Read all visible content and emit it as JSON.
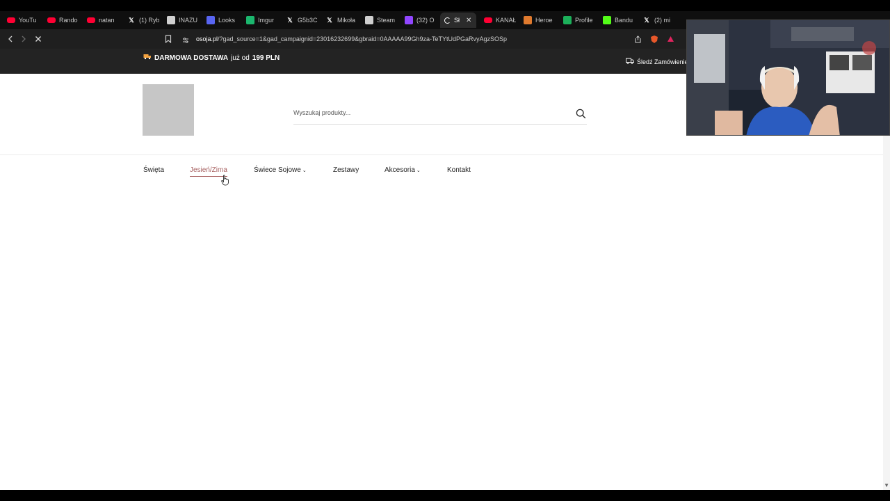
{
  "browser": {
    "tabs": [
      {
        "label": "YouTu",
        "icon": "youtube-icon",
        "color": "#ff0033"
      },
      {
        "label": "Rando",
        "icon": "youtube-icon",
        "color": "#ff0033"
      },
      {
        "label": "natan",
        "icon": "youtube-icon",
        "color": "#ff0033"
      },
      {
        "label": "(1) Ryb",
        "icon": "x-icon",
        "color": "#ffffff"
      },
      {
        "label": "INAZU",
        "icon": "stack-icon",
        "color": "#d0d0d0"
      },
      {
        "label": "Looks",
        "icon": "discord-icon",
        "color": "#5865f2"
      },
      {
        "label": "Imgur",
        "icon": "imgur-icon",
        "color": "#1bb76e"
      },
      {
        "label": "G5b3C",
        "icon": "x-icon",
        "color": "#ffffff"
      },
      {
        "label": "Mikoła",
        "icon": "x-icon",
        "color": "#ffffff"
      },
      {
        "label": "Steam",
        "icon": "stack-icon",
        "color": "#d0d0d0"
      },
      {
        "label": "(32) O",
        "icon": "twitch-icon",
        "color": "#9146ff"
      },
      {
        "label": "Sł",
        "icon": "loading-icon",
        "color": "#ffffff",
        "active": true
      },
      {
        "label": "KANAŁ",
        "icon": "youtube-icon",
        "color": "#ff0033"
      },
      {
        "label": "Heroe",
        "icon": "heroes-icon",
        "color": "#e07a2e"
      },
      {
        "label": "Profile",
        "icon": "profile-icon",
        "color": "#1cb05a"
      },
      {
        "label": "Bandu",
        "icon": "kick-icon",
        "color": "#53fc18"
      },
      {
        "label": "(2) mi",
        "icon": "x-icon",
        "color": "#ffffff"
      }
    ],
    "url_host": "osoja.pl",
    "url_path": "/?gad_source=1&gad_campaignid=23016232699&gbraid=0AAAAA99Gh9za-TeTYtUdPGaRvyAgzSOSp"
  },
  "site": {
    "promo": {
      "icon": "truck-icon",
      "bold": "DARMOWA DOSTAWA",
      "rest": "już od",
      "amount": "199 PLN"
    },
    "track_order": "Śledź Zamówienie",
    "search": {
      "placeholder": "Wyszukaj produkty..."
    },
    "nav": [
      {
        "label": "Święta",
        "dropdown": false
      },
      {
        "label": "Jesień/Zima",
        "dropdown": false,
        "active": true
      },
      {
        "label": "Świece Sojowe",
        "dropdown": true
      },
      {
        "label": "Zestawy",
        "dropdown": false
      },
      {
        "label": "Akcesoria",
        "dropdown": true
      },
      {
        "label": "Kontakt",
        "dropdown": false
      }
    ],
    "accent_color": "#a65f5f"
  }
}
